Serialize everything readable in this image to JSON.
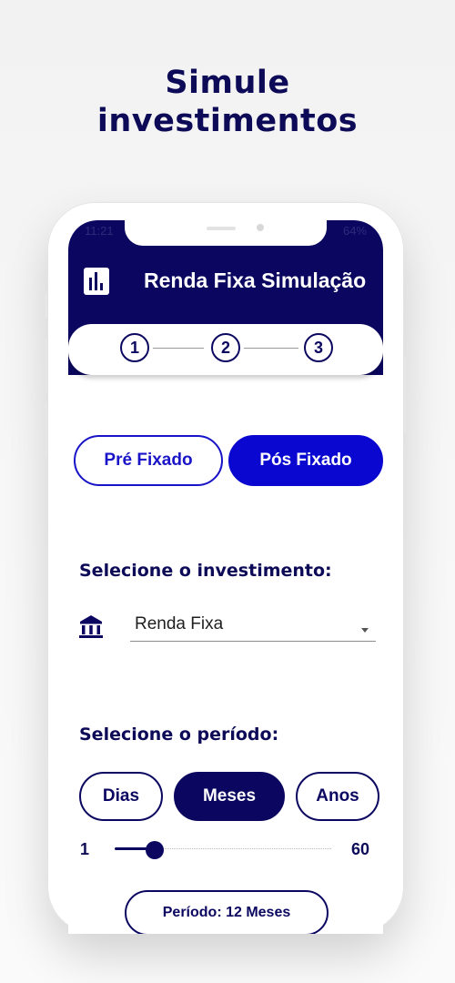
{
  "headline": {
    "line1": "Simule",
    "line2": "investimentos"
  },
  "status_bar": {
    "time": "11:21",
    "battery": "64%"
  },
  "app_bar": {
    "title": "Renda Fixa Simulação",
    "icon": "bar-chart-icon"
  },
  "stepper": {
    "steps": [
      "1",
      "2",
      "3"
    ]
  },
  "investment_type": {
    "options": [
      "Pré Fixado",
      "Pós Fixado"
    ],
    "selected": "Pós Fixado"
  },
  "investment": {
    "label": "Selecione o investimento:",
    "icon": "bank-icon",
    "selected": "Renda Fixa"
  },
  "period": {
    "label": "Selecione o período:",
    "units": [
      "Dias",
      "Meses",
      "Anos"
    ],
    "selected_unit": "Meses",
    "slider": {
      "min": "1",
      "max": "60",
      "value": 12
    },
    "summary": "Período: 12 Meses"
  },
  "colors": {
    "primary": "#0b0760",
    "accent": "#0a07d0",
    "outline_accent": "#1a14c8",
    "text_dark": "#0d0a57"
  }
}
